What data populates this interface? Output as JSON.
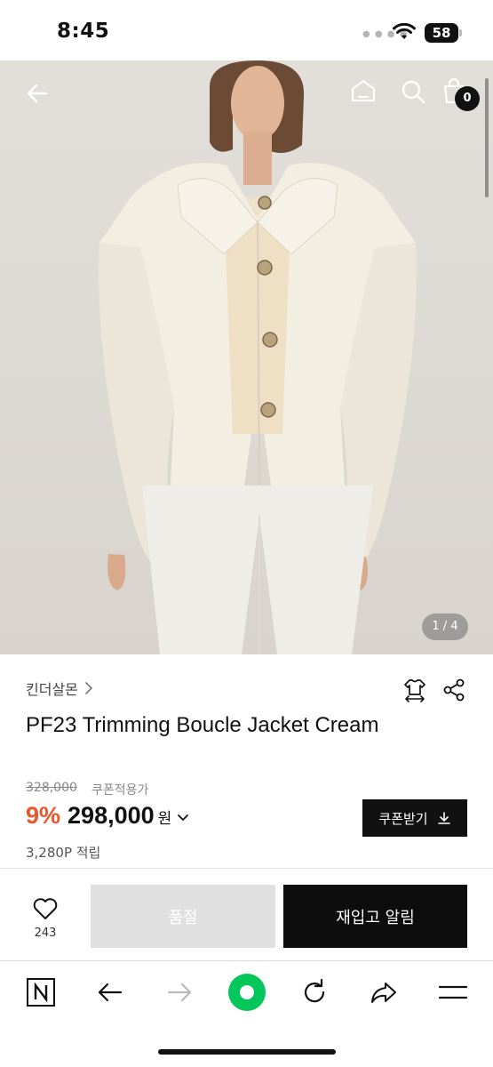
{
  "status_bar": {
    "time": "8:45",
    "battery": "58"
  },
  "hero": {
    "page_indicator": "1 / 4"
  },
  "header": {
    "cart_count": "0"
  },
  "product": {
    "brand": "킨더살몬",
    "title": "PF23 Trimming Boucle Jacket Cream",
    "original_price": "328,000",
    "coupon_note": "쿠폰적용가",
    "discount": "9%",
    "sale_price": "298,000",
    "currency": "원",
    "coupon_button": "쿠폰받기",
    "points": "3,280P 적립"
  },
  "actions": {
    "like_count": "243",
    "soldout_label": "품절",
    "restock_label": "재입고 알림"
  },
  "colors": {
    "discount": "#e8562a",
    "primary": "#0d0d0d",
    "disabled": "#e0e0e0",
    "naver_green": "#03c75a"
  },
  "icons": [
    "back-arrow-icon",
    "home-icon",
    "search-icon",
    "cart-icon",
    "size-guide-icon",
    "share-icon",
    "heart-icon",
    "naver-icon",
    "browser-back-icon",
    "browser-forward-icon",
    "green-dot-icon",
    "refresh-icon",
    "share-forward-icon",
    "menu-icon"
  ]
}
